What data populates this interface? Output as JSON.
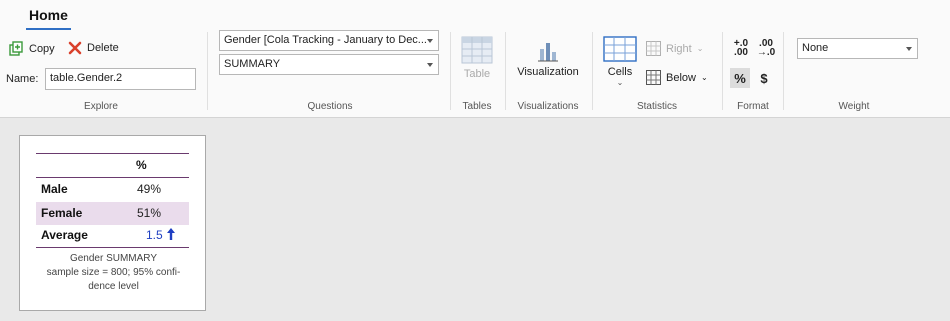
{
  "ribbon": {
    "tab_home": "Home",
    "explore": {
      "label": "Explore",
      "copy": "Copy",
      "delete": "Delete",
      "name_label": "Name:",
      "name_value": "table.Gender.2"
    },
    "questions": {
      "label": "Questions",
      "row_question": "Gender [Cola Tracking - January to Dec...",
      "column_question": "SUMMARY"
    },
    "tables": {
      "label": "Tables",
      "table": "Table"
    },
    "visualizations": {
      "label": "Visualizations",
      "visualization": "Visualization"
    },
    "statistics": {
      "label": "Statistics",
      "cells": "Cells",
      "right": "Right",
      "below": "Below"
    },
    "format": {
      "label": "Format",
      "increase_decimals": "+.0 .00",
      "decrease_decimals": ".00 →.0",
      "percent": "%",
      "currency": "$"
    },
    "weight": {
      "label": "Weight",
      "value": "None"
    }
  },
  "output": {
    "header": "%",
    "rows": [
      {
        "label": "Male",
        "value": "49%"
      },
      {
        "label": "Female",
        "value": "51%"
      },
      {
        "label": "Average",
        "value": "1.5"
      }
    ],
    "footnote_1": "Gender SUMMARY",
    "footnote_2": "sample size = 800; 95% confi-",
    "footnote_3": "dence level"
  },
  "colors": {
    "accent": "#2f6fc4",
    "table_rule": "#6a3a6e",
    "shaded_row": "#eadcec",
    "significance_up": "#1f3fc2",
    "delete_icon": "#d9402b",
    "copy_icon": "#3a9a3a"
  }
}
